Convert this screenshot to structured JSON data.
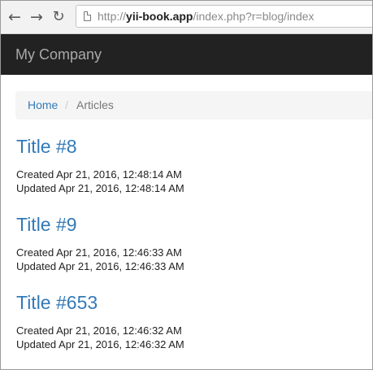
{
  "browser": {
    "url_scheme": "http://",
    "url_host": "yii-book.app",
    "url_path": "/index.php?r=blog/index",
    "back_icon": "arrow-left",
    "forward_icon": "arrow-right",
    "reload_icon": "reload"
  },
  "navbar": {
    "brand": "My Company"
  },
  "breadcrumb": {
    "home": "Home",
    "separator": "/",
    "current": "Articles"
  },
  "articles": [
    {
      "title": "Title #8",
      "created": "Created Apr 21, 2016, 12:48:14 AM",
      "updated": "Updated Apr 21, 2016, 12:48:14 AM"
    },
    {
      "title": "Title #9",
      "created": "Created Apr 21, 2016, 12:46:33 AM",
      "updated": "Updated Apr 21, 2016, 12:46:33 AM"
    },
    {
      "title": "Title #653",
      "created": "Created Apr 21, 2016, 12:46:32 AM",
      "updated": "Updated Apr 21, 2016, 12:46:32 AM"
    }
  ],
  "colors": {
    "link": "#337ab7",
    "navbar_bg": "#222222",
    "brand_text": "#a9a9a9",
    "breadcrumb_bg": "#f5f5f5"
  }
}
